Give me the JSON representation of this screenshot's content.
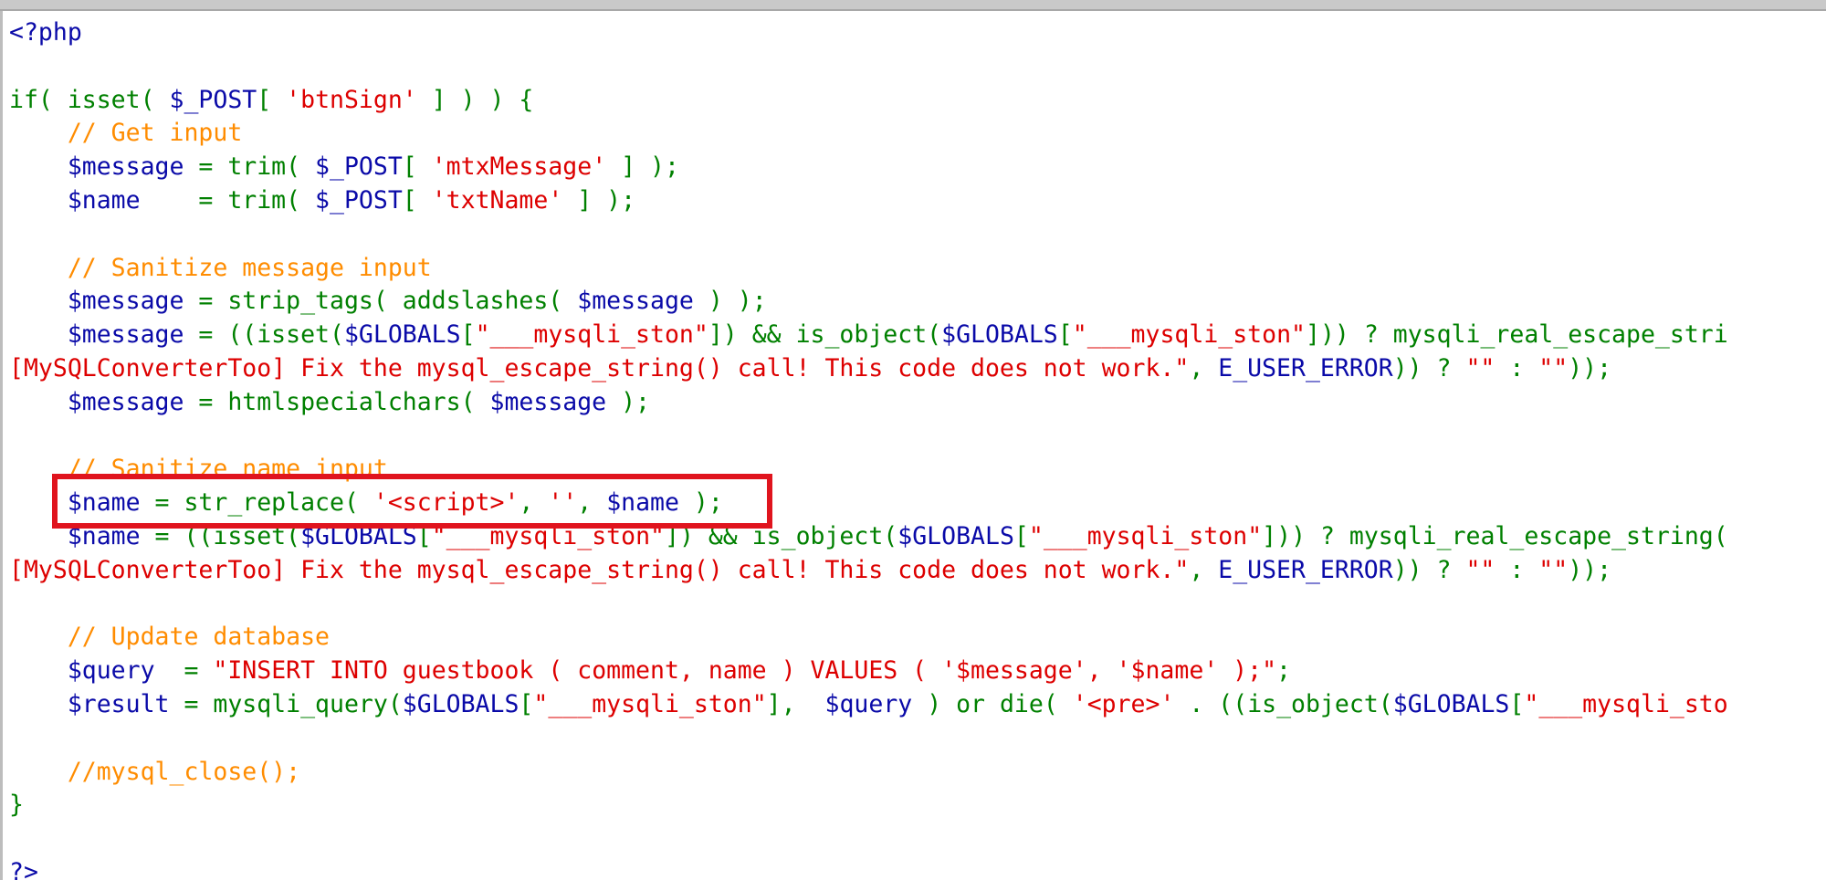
{
  "lines": [
    [
      [
        "tag",
        "<?php"
      ]
    ],
    [],
    [
      [
        "kw",
        "if( isset( "
      ],
      [
        "var",
        "$_POST"
      ],
      [
        "punct",
        "[ "
      ],
      [
        "str",
        "'btnSign'"
      ],
      [
        "punct",
        " ] ) ) {"
      ]
    ],
    [
      [
        "com",
        "    // Get input"
      ]
    ],
    [
      [
        "var",
        "    $message"
      ],
      [
        "punct",
        " = trim( "
      ],
      [
        "var",
        "$_POST"
      ],
      [
        "punct",
        "[ "
      ],
      [
        "str",
        "'mtxMessage'"
      ],
      [
        "punct",
        " ] );"
      ]
    ],
    [
      [
        "var",
        "    $name"
      ],
      [
        "punct",
        "    = trim( "
      ],
      [
        "var",
        "$_POST"
      ],
      [
        "punct",
        "[ "
      ],
      [
        "str",
        "'txtName'"
      ],
      [
        "punct",
        " ] );"
      ]
    ],
    [],
    [
      [
        "com",
        "    // Sanitize message input"
      ]
    ],
    [
      [
        "var",
        "    $message"
      ],
      [
        "punct",
        " = strip_tags( addslashes( "
      ],
      [
        "var",
        "$message"
      ],
      [
        "punct",
        " ) );"
      ]
    ],
    [
      [
        "var",
        "    $message"
      ],
      [
        "punct",
        " = ((isset("
      ],
      [
        "var",
        "$GLOBALS"
      ],
      [
        "punct",
        "["
      ],
      [
        "str",
        "\"___mysqli_ston\""
      ],
      [
        "punct",
        "]) && is_object("
      ],
      [
        "var",
        "$GLOBALS"
      ],
      [
        "punct",
        "["
      ],
      [
        "str",
        "\"___mysqli_ston\""
      ],
      [
        "punct",
        "])) ? mysqli_real_escape_stri"
      ]
    ],
    [
      [
        "str",
        "[MySQLConverterToo] Fix the mysql_escape_string() call! This code does not work.\""
      ],
      [
        "punct",
        ", "
      ],
      [
        "const",
        "E_USER_ERROR"
      ],
      [
        "punct",
        ")) ? "
      ],
      [
        "str",
        "\"\""
      ],
      [
        "punct",
        " : "
      ],
      [
        "str",
        "\"\""
      ],
      [
        "punct",
        "));"
      ]
    ],
    [
      [
        "var",
        "    $message"
      ],
      [
        "punct",
        " = htmlspecialchars( "
      ],
      [
        "var",
        "$message"
      ],
      [
        "punct",
        " );"
      ]
    ],
    [],
    [
      [
        "com",
        "    // Sanitize name input"
      ]
    ],
    [
      [
        "var",
        "    $name"
      ],
      [
        "punct",
        " = str_replace( "
      ],
      [
        "str",
        "'<script>'"
      ],
      [
        "punct",
        ", "
      ],
      [
        "str",
        "''"
      ],
      [
        "punct",
        ", "
      ],
      [
        "var",
        "$name"
      ],
      [
        "punct",
        " );"
      ]
    ],
    [
      [
        "var",
        "    $name"
      ],
      [
        "punct",
        " = ((isset("
      ],
      [
        "var",
        "$GLOBALS"
      ],
      [
        "punct",
        "["
      ],
      [
        "str",
        "\"___mysqli_ston\""
      ],
      [
        "punct",
        "]) && is_object("
      ],
      [
        "var",
        "$GLOBALS"
      ],
      [
        "punct",
        "["
      ],
      [
        "str",
        "\"___mysqli_ston\""
      ],
      [
        "punct",
        "])) ? mysqli_real_escape_string("
      ]
    ],
    [
      [
        "str",
        "[MySQLConverterToo] Fix the mysql_escape_string() call! This code does not work.\""
      ],
      [
        "punct",
        ", "
      ],
      [
        "const",
        "E_USER_ERROR"
      ],
      [
        "punct",
        ")) ? "
      ],
      [
        "str",
        "\"\""
      ],
      [
        "punct",
        " : "
      ],
      [
        "str",
        "\"\""
      ],
      [
        "punct",
        "));"
      ]
    ],
    [],
    [
      [
        "com",
        "    // Update database"
      ]
    ],
    [
      [
        "var",
        "    $query"
      ],
      [
        "punct",
        "  = "
      ],
      [
        "str",
        "\"INSERT INTO guestbook ( comment, name ) VALUES ( '$message', '$name' );\""
      ],
      [
        "punct",
        ";"
      ]
    ],
    [
      [
        "var",
        "    $result"
      ],
      [
        "punct",
        " = mysqli_query("
      ],
      [
        "var",
        "$GLOBALS"
      ],
      [
        "punct",
        "["
      ],
      [
        "str",
        "\"___mysqli_ston\""
      ],
      [
        "punct",
        "],  "
      ],
      [
        "var",
        "$query"
      ],
      [
        "punct",
        " ) or die( "
      ],
      [
        "str",
        "'<pre>'"
      ],
      [
        "punct",
        " . ((is_object("
      ],
      [
        "var",
        "$GLOBALS"
      ],
      [
        "punct",
        "["
      ],
      [
        "str",
        "\"___mysqli_sto"
      ]
    ],
    [],
    [
      [
        "com",
        "    //mysql_close();"
      ]
    ],
    [
      [
        "punct",
        "}"
      ]
    ],
    [],
    [
      [
        "tag",
        "?>"
      ]
    ]
  ],
  "colors": {
    "keyword": "#008000",
    "variable": "#0a0aa8",
    "string": "#dd0000",
    "comment": "#ff8c00",
    "highlight_border": "#e0141e"
  }
}
